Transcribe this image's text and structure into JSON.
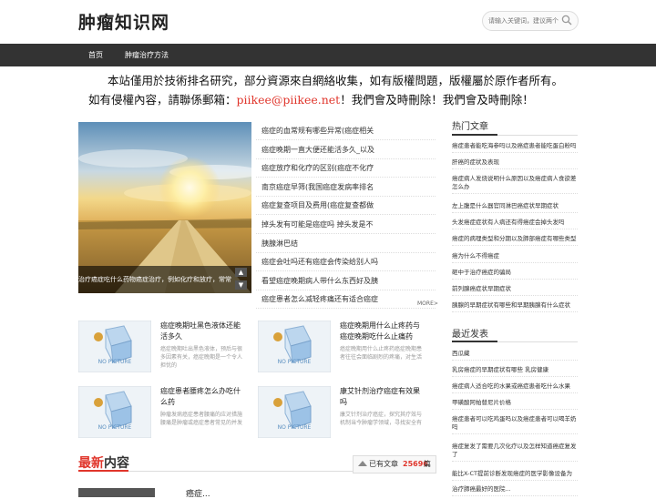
{
  "site": {
    "logo": "肿瘤知识网"
  },
  "search": {
    "placeholder": "请输入关键词，建议两个"
  },
  "nav": {
    "items": [
      "首页",
      "肿瘤治疗方法"
    ]
  },
  "notice": {
    "line1": "本站僅用於技術排名研究，部分資源來自網絡收集，如有版權問題，版權屬於原作者所有。",
    "line2_prefix": "如有侵權內容，請聯係郵箱：",
    "line2_email": "piikee@piikee.net",
    "line2_suffix": "！我們會及時刪除！我們會及時刪除！"
  },
  "slider": {
    "caption": "治疗癌症吃什么药物癌症治疗，例如化疗和放疗，常常会...",
    "up_arrow": "▲",
    "down_arrow": "▼"
  },
  "top_list": [
    "癌症的血常规有哪些异常(癌症相关",
    "癌症晚期一直大便还能活多久_以及",
    "癌症放疗和化疗的区别(癌症不化疗",
    "南京癌症早筛(我国癌症发病率排名",
    "癌症复查项目及费用(癌症复查都做",
    "掉头发有可能是癌症吗 掉头发是不",
    "胰腺淋巴结",
    "癌症会吐吗还有癌症会传染给别人吗",
    "看望癌症晚期病人带什么东西好及胰",
    "癌症患者怎么减轻疼痛还有适合癌症"
  ],
  "more_label": "MORE>",
  "cards": [
    {
      "title": "癌症晚期吐黑色液体还能活多久",
      "excerpt": "癌症晚期吐出黑色液体，预后与很多因素有关，癌症晚期是一个令人担忧的",
      "nopic": "NO PICTURE"
    },
    {
      "title": "癌症晚期用什么止疼药与癌症晚期吃什么止痛药",
      "excerpt": "癌症晚期用什么止疼药癌症晚期患者往往会面临剧烈的疼痛，对生活",
      "nopic": "NO PICTURE"
    },
    {
      "title": "癌症患者腰疼怎么办吃什么药",
      "excerpt": "肿瘤发病癌症患者腰痛的应对措施腰痛是肿瘤或癌症患者常见的并发",
      "nopic": "NO PICTURE"
    },
    {
      "title": "康艾针剂治疗癌症有效果吗",
      "excerpt": "康艾针剂治疗癌症，探究其疗效与机制当今肿瘤学领域，寻找安全有",
      "nopic": "NO PICTURE"
    }
  ],
  "latest": {
    "red": "最新",
    "rest": "内容"
  },
  "counter": {
    "label": "已有文章",
    "count": "25696",
    "unit": "篇"
  },
  "bottom": {
    "first_title": "癌症..."
  },
  "sidebar": {
    "hot_title": "热门文章",
    "hot": [
      "癌症患者能吃海参吗以及癌症患者能吃蛋白粉吗",
      "肝癌的症状及表现",
      "癌症病人发烧说明什么原因以及癌症病人食欲差怎么办",
      "左上腹是什么器官同淋巴癌症状早期症状",
      "头发癌症症状有人病还有得癌症会掉头发吗",
      "癌症的病理类型和分期以及肺部癌症有哪些类型",
      "癌为什么不得癌症",
      "砸中于治疗癌症的骗局",
      "前列腺癌症状早期症状",
      "胰腺的早期症状有哪些和早期胰腺有什么症状"
    ],
    "recent_title": "最近发表",
    "recent": [
      "西瓜藏",
      "乳房癌症的早期症状有哪些 乳房健康",
      "癌症病人适合吃的水果或癌症患者吃什么水果",
      "甲磺酸阿帕替尼片价格",
      "癌症患者可以吃鸡蛋吗以及癌症患者可以喝羊奶吗",
      "癌症复发了需要几次化疗以及怎样知道癌症复发了",
      "能比X-CT提前诊断发现癌症的医学影像设备为",
      "治疗肺癌最好的医院..."
    ]
  },
  "colors": {
    "accent_red": "#e0352b",
    "nav_bg": "#333333"
  }
}
